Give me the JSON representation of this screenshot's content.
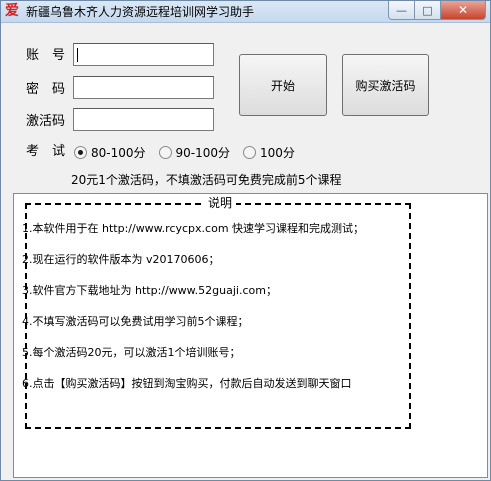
{
  "window": {
    "title": "新疆乌鲁木齐人力资源远程培训网学习助手",
    "icon_glyph": "爱",
    "min_glyph": "—",
    "max_glyph": "□",
    "close_glyph": "✕"
  },
  "form": {
    "account_label": "账　号",
    "account_value": "",
    "password_label": "密　码",
    "password_value": "",
    "activation_label": "激活码",
    "activation_value": "",
    "exam_label": "考　试",
    "exam_options": [
      {
        "label": "80-100分",
        "checked": true
      },
      {
        "label": "90-100分",
        "checked": false
      },
      {
        "label": "100分",
        "checked": false
      }
    ]
  },
  "buttons": {
    "start": "开始",
    "buy": "购买激活码"
  },
  "hint": "20元1个激活码，不填激活码可免费完成前5个课程",
  "instructions": {
    "title": "说明",
    "items": [
      "1.本软件用于在 http://www.rcycpx.com 快速学习课程和完成测试；",
      "2.现在运行的软件版本为 v20170606；",
      "3.软件官方下载地址为 http://www.52guaji.com；",
      "4.不填写激活码可以免费试用学习前5个课程；",
      "5.每个激活码20元，可以激活1个培训账号；",
      "6.点击【购买激活码】按钮到淘宝购买，付款后自动发送到聊天窗口"
    ]
  }
}
